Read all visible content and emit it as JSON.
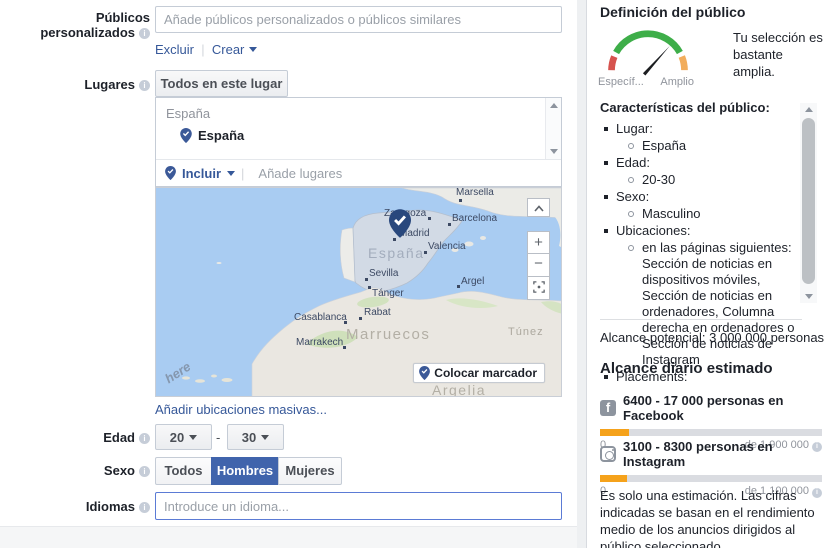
{
  "left": {
    "custom_audiences": {
      "label": "Públicos personalizados",
      "placeholder": "Añade públicos personalizados o públicos similares",
      "exclude_link": "Excluir",
      "create_link": "Crear"
    },
    "places": {
      "label": "Lugares",
      "mode_button": "Todos en este lugar",
      "list_group": "España",
      "list_item": "España",
      "include_label": "Incluir",
      "add_placeholder": "Añade lugares",
      "bulk_link": "Añadir ubicaciones masivas..."
    },
    "age": {
      "label": "Edad",
      "from": "20",
      "to": "30",
      "dash": "-"
    },
    "gender": {
      "label": "Sexo",
      "options": [
        "Todos",
        "Hombres",
        "Mujeres"
      ],
      "selected": "Hombres"
    },
    "languages": {
      "label": "Idiomas",
      "placeholder": "Introduce un idioma..."
    }
  },
  "map": {
    "cities": [
      {
        "name": "Marsella"
      },
      {
        "name": "Zaragoza"
      },
      {
        "name": "Barcelona"
      },
      {
        "name": "Madrid"
      },
      {
        "name": "Valencia"
      },
      {
        "name": "Sevilla"
      },
      {
        "name": "Argel"
      },
      {
        "name": "Tánger"
      },
      {
        "name": "Rabat"
      },
      {
        "name": "Casablanca"
      },
      {
        "name": "Marrakech"
      }
    ],
    "regions": [
      {
        "name": "España"
      },
      {
        "name": "Marruecos"
      },
      {
        "name": "Túnez"
      },
      {
        "name": "Argelia"
      }
    ],
    "marker_button": "Colocar marcador",
    "watermark": "here"
  },
  "right": {
    "title": "Definición del público",
    "gauge": {
      "left_label": "Específ...",
      "right_label": "Amplio",
      "message": "Tu selección es bastante amplia."
    },
    "characteristics": {
      "title": "Características del público:",
      "items": [
        {
          "label": "Lugar:",
          "value": "España"
        },
        {
          "label": "Edad:",
          "value": "20-30"
        },
        {
          "label": "Sexo:",
          "value": "Masculino"
        },
        {
          "label": "Ubicaciones:",
          "value": "en las páginas siguientes: Sección de noticias en dispositivos móviles, Sección de noticias en ordenadores, Columna derecha en ordenadores o Sección de noticias de Instagram"
        },
        {
          "label": "Placements:",
          "value": ""
        }
      ]
    },
    "potential_reach": "Alcance potencial: 3 000 000 personas",
    "daily_reach": {
      "title": "Alcance diario estimado",
      "rows": [
        {
          "network": "Facebook",
          "text": "6400 - 17 000 personas en Facebook",
          "min": "0",
          "max": "de 1 900 000",
          "fill_pct": 13
        },
        {
          "network": "Instagram",
          "text": "3100 - 8300 personas en Instagram",
          "min": "0",
          "max": "de 1 100 000",
          "fill_pct": 12
        }
      ]
    },
    "disclaimer": "Es solo una estimación. Las cifras indicadas se basan en el rendimiento medio de los anuncios dirigidos al público seleccionado."
  },
  "colors": {
    "link_blue": "#365899",
    "selected_blue": "#4064ac",
    "bar_orange": "#f5a21b",
    "gauge_red": "#d6534e",
    "gauge_green": "#3eae49",
    "gauge_orange": "#f2ad5c",
    "pin_navy": "#29487d"
  }
}
